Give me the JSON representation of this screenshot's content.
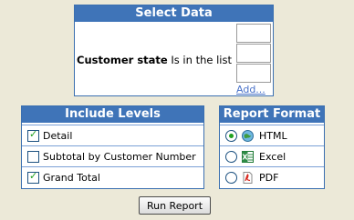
{
  "select_data": {
    "title": "Select Data",
    "criteria_field": "Customer state",
    "criteria_operator": "Is in the list",
    "add_link": "Add..."
  },
  "include_levels": {
    "title": "Include Levels",
    "items": [
      {
        "label": "Detail",
        "checked": true
      },
      {
        "label": "Subtotal by Customer Number",
        "checked": false
      },
      {
        "label": "Grand Total",
        "checked": true
      }
    ]
  },
  "report_format": {
    "title": "Report Format",
    "options": [
      {
        "label": "HTML",
        "selected": true,
        "icon": "html-icon"
      },
      {
        "label": "Excel",
        "selected": false,
        "icon": "excel-icon"
      },
      {
        "label": "PDF",
        "selected": false,
        "icon": "pdf-icon"
      }
    ]
  },
  "run_button": "Run Report",
  "colors": {
    "header_bg": "#3f74b8",
    "background": "#ece9d8",
    "check_green": "#21a121",
    "link": "#4a72c9"
  }
}
